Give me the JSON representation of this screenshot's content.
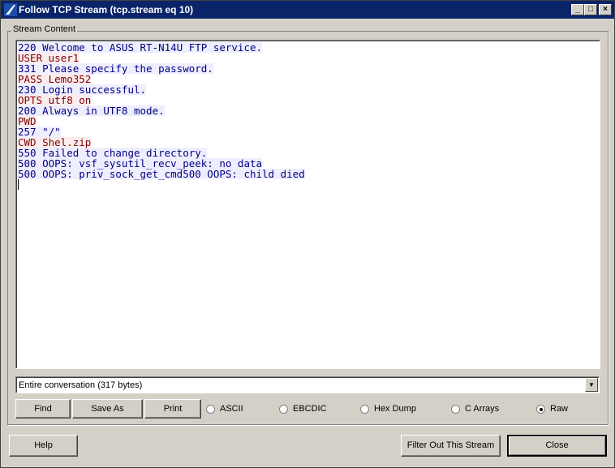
{
  "window": {
    "title": "Follow TCP Stream (tcp.stream eq 10)",
    "controls": {
      "minimize": "_",
      "maximize": "□",
      "close": "×"
    }
  },
  "group": {
    "label": "Stream Content"
  },
  "stream_lines": [
    {
      "dir": "server",
      "text": "220 Welcome to ASUS RT-N14U FTP service."
    },
    {
      "dir": "client",
      "text": "USER user1"
    },
    {
      "dir": "server",
      "text": "331 Please specify the password."
    },
    {
      "dir": "client",
      "text": "PASS Lemo352"
    },
    {
      "dir": "server",
      "text": "230 Login successful."
    },
    {
      "dir": "client",
      "text": "OPTS utf8 on"
    },
    {
      "dir": "server",
      "text": "200 Always in UTF8 mode."
    },
    {
      "dir": "client",
      "text": "PWD"
    },
    {
      "dir": "server",
      "text": "257 \"/\""
    },
    {
      "dir": "client",
      "text": "CWD Shel.zip"
    },
    {
      "dir": "server",
      "text": "550 Failed to change directory."
    },
    {
      "dir": "server",
      "text": "500 OOPS: vsf_sysutil_recv_peek: no data"
    },
    {
      "dir": "server",
      "text": "500 OOPS: priv_sock_get_cmd500 OOPS: child died"
    }
  ],
  "conversation_select": {
    "value": "Entire conversation (317 bytes)"
  },
  "buttons": {
    "find": "Find",
    "save_as": "Save As",
    "print": "Print",
    "help": "Help",
    "filter_out": "Filter Out This Stream",
    "close": "Close"
  },
  "formats": [
    {
      "label": "ASCII",
      "selected": false
    },
    {
      "label": "EBCDIC",
      "selected": false
    },
    {
      "label": "Hex Dump",
      "selected": false
    },
    {
      "label": "C Arrays",
      "selected": false
    },
    {
      "label": "Raw",
      "selected": true
    }
  ],
  "colors": {
    "titlebar": "#0a246a",
    "server_text": "#000080",
    "server_bg": "#eeeeff",
    "client_text": "#800000",
    "client_bg": "#fbeded"
  }
}
